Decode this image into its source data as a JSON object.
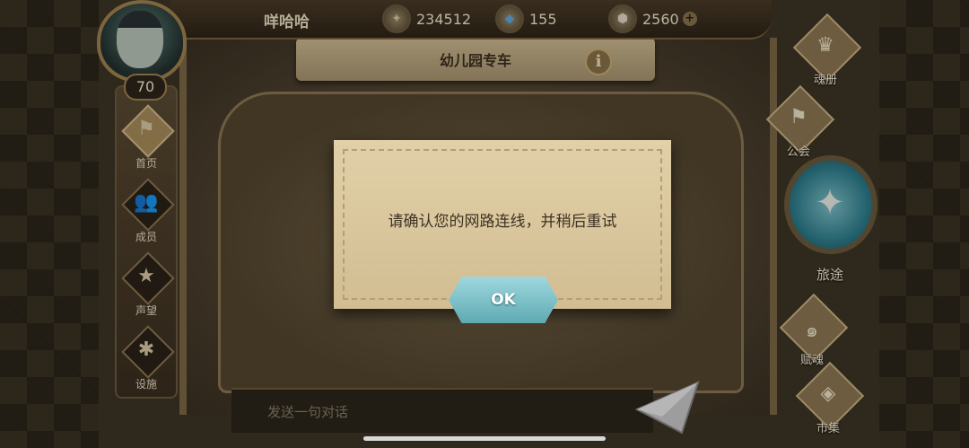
{
  "player": {
    "name": "咩哈哈",
    "level": "70"
  },
  "currencies": [
    {
      "icon": "gold-coin-icon",
      "value": "234512"
    },
    {
      "icon": "blue-crystal-icon",
      "value": "155"
    },
    {
      "icon": "stone-icon",
      "value": "2560"
    }
  ],
  "guild": {
    "name": "幼儿园专车"
  },
  "left_nav": [
    {
      "label": "首页",
      "icon": "home-icon"
    },
    {
      "label": "成员",
      "icon": "members-icon"
    },
    {
      "label": "声望",
      "icon": "reputation-icon"
    },
    {
      "label": "设施",
      "icon": "facility-icon"
    }
  ],
  "right_nav": {
    "book": "魂册",
    "guild": "公会",
    "journey": "旅途",
    "bestow": "赋魂",
    "market": "市集"
  },
  "chat": {
    "placeholder": "发送一句对话"
  },
  "dialog": {
    "message": "请确认您的网路连线，并稍后重试",
    "ok_label": "OK"
  }
}
